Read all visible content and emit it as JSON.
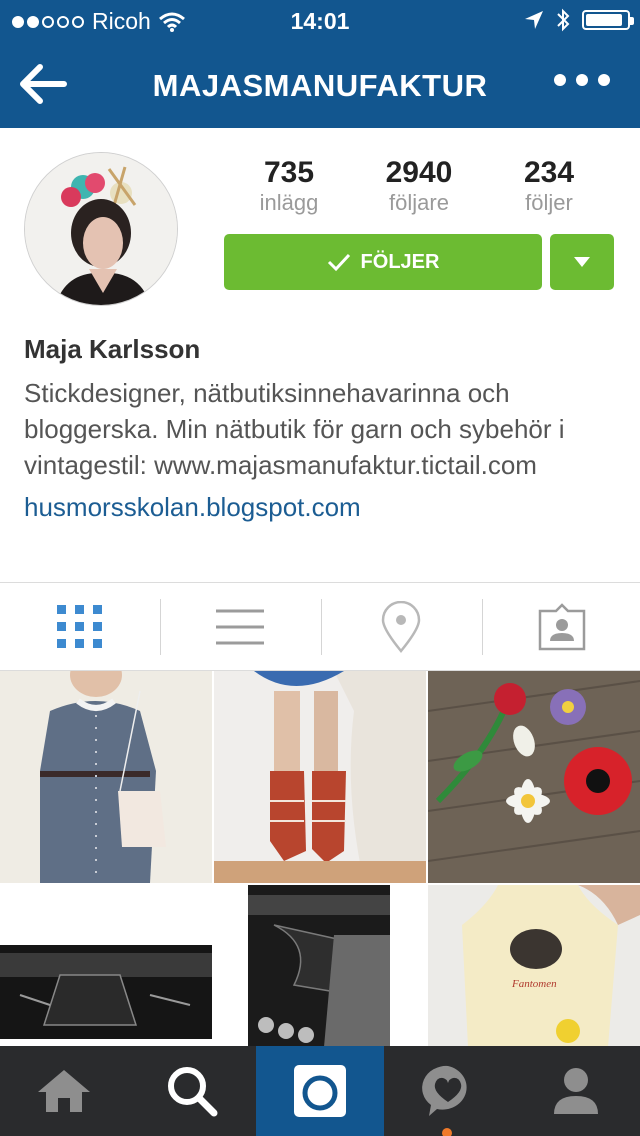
{
  "status_bar": {
    "carrier": "Ricoh",
    "time": "14:01",
    "signal_dots_filled": 2,
    "signal_dots_total": 5,
    "battery_level": 0.9
  },
  "header": {
    "title": "MAJASMANUFAKTUR",
    "background_color": "#12568f"
  },
  "profile": {
    "stats": [
      {
        "value": "735",
        "label": "inlägg"
      },
      {
        "value": "2940",
        "label": "följare"
      },
      {
        "value": "234",
        "label": "följer"
      }
    ],
    "follow_button_label": "FÖLJER",
    "follow_button_color": "#6cbb32",
    "name": "Maja Karlsson",
    "bio": "Stickdesigner, nätbutiksinnehavarinna och bloggerska. Min nätbutik för garn och sybehör i vintagestil: www.majasmanufaktur.tictail.com",
    "website": "husmorsskolan.blogspot.com"
  },
  "view_tabs": [
    {
      "icon": "grid-icon",
      "active": true
    },
    {
      "icon": "list-icon",
      "active": false
    },
    {
      "icon": "location-pin-icon",
      "active": false
    },
    {
      "icon": "tagged-person-icon",
      "active": false
    }
  ],
  "bottom_nav": [
    {
      "icon": "home-icon",
      "active": false
    },
    {
      "icon": "search-icon",
      "active": false
    },
    {
      "icon": "camera-icon",
      "active": true
    },
    {
      "icon": "activity-heart-icon",
      "active": false
    },
    {
      "icon": "profile-icon",
      "active": false
    }
  ],
  "colors": {
    "accent_blue": "#12568f",
    "link_blue": "#1c5d93",
    "follow_green": "#6cbb32",
    "nav_dark": "#2a2b2d",
    "notification_orange": "#f07a2a"
  }
}
